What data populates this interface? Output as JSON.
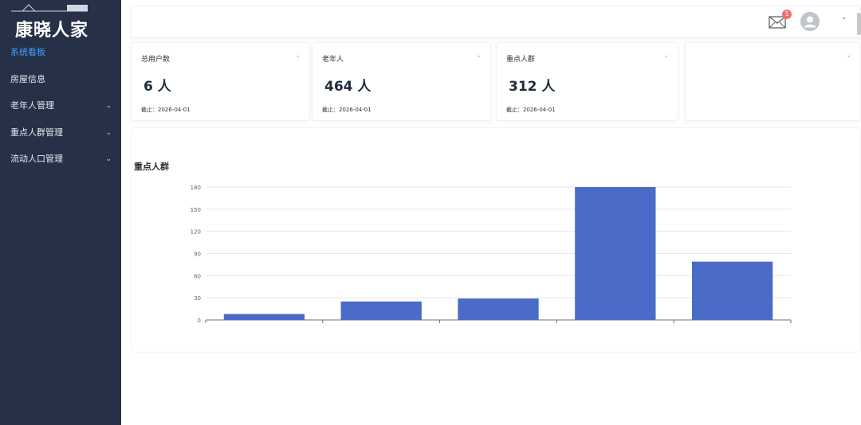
{
  "app": {
    "brand": "康晓人家"
  },
  "sidebar": {
    "items": [
      {
        "label": "系统看板",
        "active": true,
        "expandable": false
      },
      {
        "label": "房屋信息",
        "active": false,
        "expandable": false
      },
      {
        "label": "老年人管理",
        "active": false,
        "expandable": true
      },
      {
        "label": "重点人群管理",
        "active": false,
        "expandable": true
      },
      {
        "label": "流动人口管理",
        "active": false,
        "expandable": true
      }
    ]
  },
  "header": {
    "mail_badge": "1",
    "icons": [
      "mail-icon",
      "user-avatar-icon",
      "chevron-down-icon"
    ]
  },
  "stats": [
    {
      "title": "总用户数",
      "value": "6 人",
      "date": "截止：2026-04-01"
    },
    {
      "title": "老年人",
      "value": "464 人",
      "date": "截止：2026-04-01"
    },
    {
      "title": "重点人群",
      "value": "312 人",
      "date": "截止：2026-04-01"
    },
    {
      "title": "",
      "value": "",
      "date": ""
    }
  ],
  "colors": {
    "sidebar_bg": "#263147",
    "accent": "#409eff",
    "bar": "#4a6bc7",
    "badge": "#f56c6c"
  },
  "chart_data": {
    "type": "bar",
    "title": "重点人群",
    "categories": [
      "",
      "",
      "",
      "",
      ""
    ],
    "values": [
      8,
      25,
      29,
      180,
      79
    ],
    "ylim": [
      0,
      180
    ],
    "yticks": [
      0,
      30,
      60,
      90,
      120,
      150,
      180
    ],
    "grid": true,
    "legend": "none"
  }
}
